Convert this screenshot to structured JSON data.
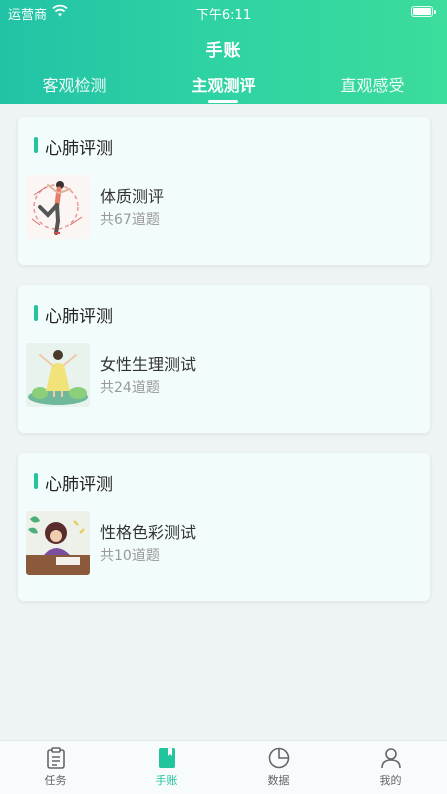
{
  "status_bar": {
    "carrier": "运营商",
    "time": "下午6:11"
  },
  "header": {
    "title": "手账"
  },
  "tabs": [
    {
      "label": "客观检测",
      "active": false
    },
    {
      "label": "主观测评",
      "active": true
    },
    {
      "label": "直观感受",
      "active": false
    }
  ],
  "cards": [
    {
      "title": "心肺评测",
      "item_title": "体质测评",
      "item_sub": "共67道题"
    },
    {
      "title": "心肺评测",
      "item_title": "女性生理测试",
      "item_sub": "共24道题"
    },
    {
      "title": "心肺评测",
      "item_title": "性格色彩测试",
      "item_sub": "共10道题"
    }
  ],
  "tabbar": [
    {
      "label": "任务",
      "icon": "clipboard-icon",
      "active": false
    },
    {
      "label": "手账",
      "icon": "notebook-icon",
      "active": true
    },
    {
      "label": "数据",
      "icon": "pie-chart-icon",
      "active": false
    },
    {
      "label": "我的",
      "icon": "user-icon",
      "active": false
    }
  ],
  "colors": {
    "accent": "#22c49d",
    "header_start": "#22c2a6",
    "header_end": "#3cdc9c",
    "background": "#eef3f5"
  }
}
